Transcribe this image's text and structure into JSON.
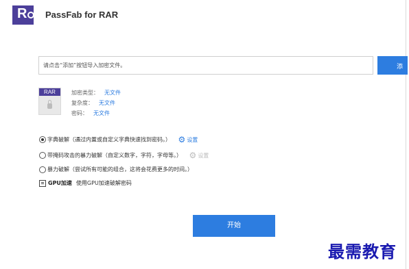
{
  "app": {
    "title": "PassFab for RAR",
    "logo_letter": "R",
    "brand_color": "#4c3f9a",
    "accent_color": "#2d7de0"
  },
  "file_input": {
    "placeholder": "请点击“添加”按钮导入加密文件。",
    "add_button_label": "添"
  },
  "file_info": {
    "icon_label": "RAR",
    "icon": "lock-icon",
    "encryption_type_label": "加密类型：",
    "encryption_type_value": "无文件",
    "complexity_label": "复杂度：",
    "complexity_value": "无文件",
    "password_label": "密码：",
    "password_value": "无文件"
  },
  "attack_options": [
    {
      "label": "字典破解（通过内置或自定义字典快速找到密码。）",
      "selected": true,
      "settings_label": "设置",
      "settings_enabled": true,
      "settings_icon": "gear-icon"
    },
    {
      "label": "带掩码攻击的暴力破解（自定义数字，字符，字母等。）",
      "selected": false,
      "settings_label": "设置",
      "settings_enabled": false,
      "settings_icon": "gear-icon"
    },
    {
      "label": "暴力破解（尝试所有可能的组合，这将会花费更多的时间。）",
      "selected": false
    }
  ],
  "gpu": {
    "label_bold": "GPU加速",
    "description": "使用GPU加速破解密码"
  },
  "start_button_label": "开始",
  "watermark": "最需教育"
}
